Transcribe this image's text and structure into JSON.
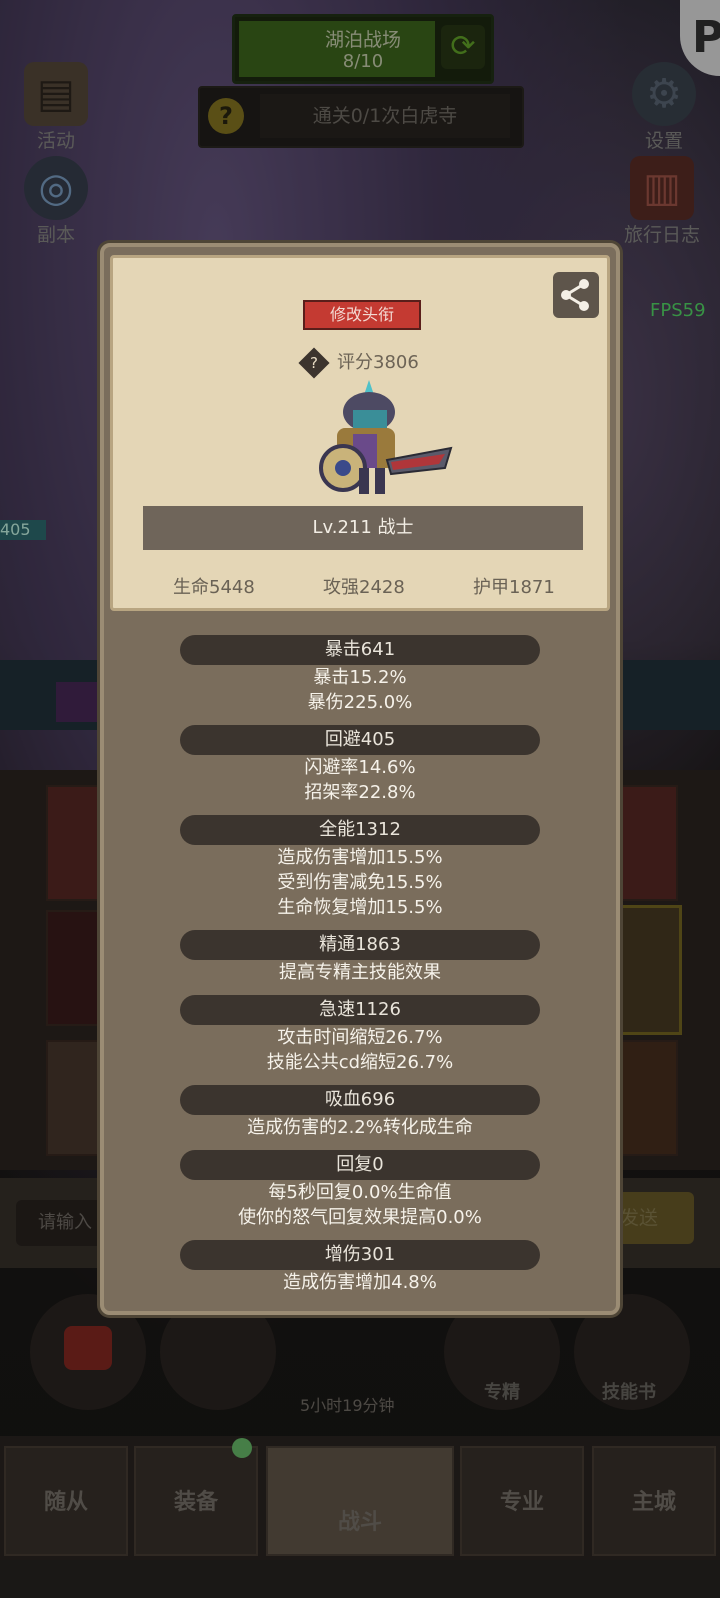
{
  "top": {
    "battle_name": "湖泊战场",
    "battle_progress": "8/10",
    "quest_text": "通关0/1次白虎寺",
    "fps": "FPS59",
    "hud_level": "405"
  },
  "left_menu": [
    {
      "label": "活动",
      "icon": "scroll-icon"
    },
    {
      "label": "副本",
      "icon": "portal-icon"
    }
  ],
  "right_menu": [
    {
      "label": "设置",
      "icon": "gear-icon"
    },
    {
      "label": "旅行日志",
      "icon": "book-icon"
    }
  ],
  "profile": {
    "rename_button": "修改头衔",
    "score": "评分3806",
    "level_class": "Lv.211 战士",
    "hp": "生命5448",
    "attack": "攻强2428",
    "armor": "护甲1871"
  },
  "stats": [
    {
      "title": "暴击641",
      "details": [
        "暴击15.2%",
        "暴伤225.0%"
      ]
    },
    {
      "title": "回避405",
      "details": [
        "闪避率14.6%",
        "招架率22.8%"
      ]
    },
    {
      "title": "全能1312",
      "details": [
        "造成伤害增加15.5%",
        "受到伤害减免15.5%",
        "生命恢复增加15.5%"
      ]
    },
    {
      "title": "精通1863",
      "details": [
        "提高专精主技能效果"
      ]
    },
    {
      "title": "急速1126",
      "details": [
        "攻击时间缩短26.7%",
        "技能公共cd缩短26.7%"
      ]
    },
    {
      "title": "吸血696",
      "details": [
        "造成伤害的2.2%转化成生命"
      ]
    },
    {
      "title": "回复0",
      "details": [
        "每5秒回复0.0%生命值",
        "使你的怒气回复效果提高0.0%"
      ]
    },
    {
      "title": "增伤301",
      "details": [
        "造成伤害增加4.8%"
      ]
    }
  ],
  "chat": {
    "placeholder": "请输入",
    "send": "发送"
  },
  "bottom": {
    "timer": "5小时19分钟",
    "skill_labels": [
      "专精",
      "技能书"
    ],
    "nav": [
      "随从",
      "装备",
      "战斗",
      "专业",
      "主城"
    ]
  },
  "colors": {
    "rename_red": "#c43a32",
    "fps_green": "#56e06a",
    "banner_green": "#3f6b1e"
  }
}
